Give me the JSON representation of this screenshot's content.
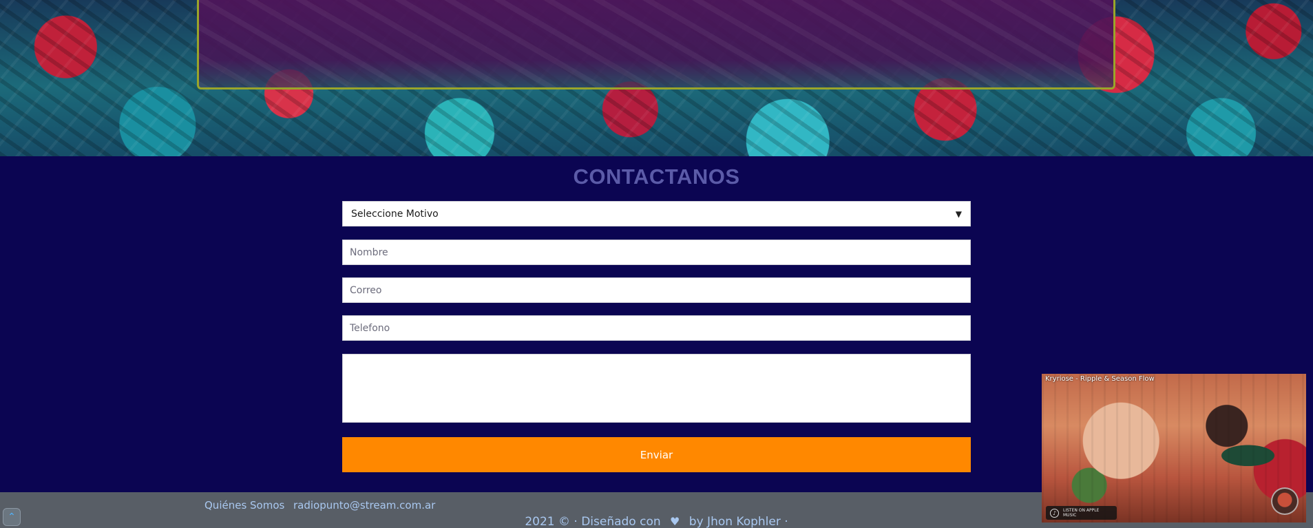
{
  "contact": {
    "title": "CONTACTANOS",
    "motivo_selected": "Seleccione Motivo",
    "nombre_placeholder": "Nombre",
    "correo_placeholder": "Correo",
    "telefono_placeholder": "Telefono",
    "mensaje_placeholder": "",
    "submit_label": "Enviar"
  },
  "footer": {
    "link_about": "Quiénes Somos",
    "link_email": "radiopunto@stream.com.ar",
    "credit_prefix": "2021 © · Diseñado con",
    "credit_suffix": "by Jhon Kophler ·",
    "heart_icon": "heart-icon",
    "link_color": "#a9c8f0"
  },
  "video": {
    "title": "Kryriose - Ripple & Season Flow",
    "badge_text": "LISTEN ON APPLE MUSIC"
  },
  "colors": {
    "accent": "#ff8800",
    "background": "#0b0552",
    "footer": "#585e66",
    "title": "#5b5ba8",
    "panel_border": "#9aa52a"
  },
  "scroll_top_icon": "chevron-up-icon"
}
